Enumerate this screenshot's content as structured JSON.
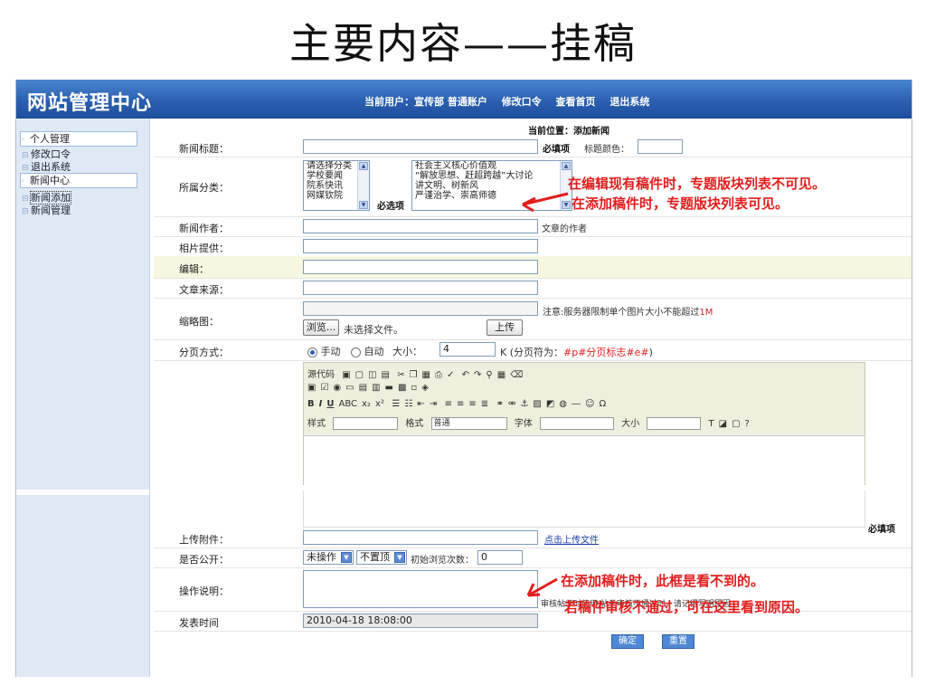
{
  "slide_title": "主要内容——挂稿",
  "app": {
    "logo": "网站管理中心",
    "nav": {
      "user_label": "当前用户：宣传部 普通账户",
      "change_password": "修改口令",
      "view_home": "查看首页",
      "logout": "退出系统"
    }
  },
  "sidebar": {
    "items": [
      {
        "label": "个人管理"
      },
      {
        "label": "修改口令"
      },
      {
        "label": "退出系统"
      },
      {
        "label": "新闻中心"
      },
      {
        "label": "新闻添加"
      },
      {
        "label": "新闻管理"
      }
    ]
  },
  "breadcrumb": "当前位置：添加新闻",
  "form": {
    "title_label": "新闻标题：",
    "required_mark": "必填项",
    "title_color_label": "标题颜色：",
    "category_label": "所属分类：",
    "category_options": [
      "请选择分类",
      "学校要闻",
      "院系快讯",
      "网媒钦院"
    ],
    "category_required": "必选项",
    "topic_options": [
      "社会主义核心价值观",
      "“解放思想、赶超跨越”大讨论",
      "讲文明、树新风",
      "严谨治学、崇高师德"
    ],
    "author_label": "新闻作者：",
    "author_note": "文章的作者",
    "photo_label": "相片提供：",
    "editor_label": "编辑：",
    "source_label": "文章来源：",
    "thumb_label": "缩略图：",
    "browse_button": "浏览...",
    "no_file": "未选择文件。",
    "upload_button": "上传",
    "thumb_note_prefix": "注意:服务器限制单个图片大小不能超过",
    "thumb_note_size": "1M",
    "paging_label": "分页方式：",
    "paging_manual": "手动",
    "paging_auto": "自动",
    "paging_size_label": "大小：",
    "paging_size_value": "4",
    "paging_unit_prefix": "K (分页符为：",
    "paging_marker": "#p#分页标志#e#",
    "paging_unit_suffix": ")",
    "editor_toolbar": {
      "source": "源代码",
      "style_label": "样式",
      "format_label": "格式",
      "format_value": "普通",
      "font_label": "字体",
      "size_label": "大小"
    },
    "editor_required": "必填项",
    "attach_label": "上传附件：",
    "attach_link": "点击上传文件",
    "public_label": "是否公开：",
    "public_select": "未操作",
    "top_select": "不置顶",
    "views_label": "初始浏览次数：",
    "views_value": "0",
    "note_label": "操作说明：",
    "note_hint": "审核帖子时使用,帖子审核不通过时，请记得写明原因",
    "publish_label": "发表时间",
    "publish_value": "2010-04-18 18:08:00",
    "ok_button": "确定",
    "reset_button": "重置"
  },
  "annotations": {
    "a1": "在编辑现有稿件时，专题版块列表不可见。",
    "a2": "在添加稿件时，专题版块列表可见。",
    "a3": "在添加稿件时，此框是看不到的。",
    "a4": "若稿件审核不通过，可在这里看到原因。"
  },
  "colors": {
    "topbar": "#2a5fb0",
    "annotation": "#e21d1d",
    "sidebar": "#dfe9f6"
  }
}
